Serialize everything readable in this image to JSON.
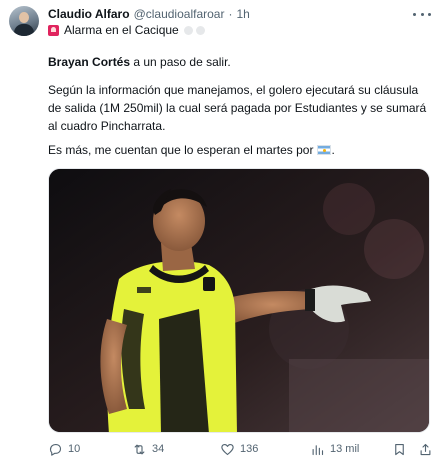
{
  "author": {
    "name": "Claudio Alfaro",
    "handle": "@claudioalfaroar",
    "separator": "·",
    "time": "1h"
  },
  "tweet": {
    "headline": "Alarma en el Cacique",
    "lead_bold": "Brayan Cortés",
    "lead_rest": " a un paso de salir.",
    "paragraph2": "Según la información que manejamos, el golero ejecutará su cláusula de salida (1M 250mil) la cual será pagada por Estudiantes y se sumará al cuadro Pincharrata.",
    "paragraph3": "Es más, me cuentan que lo esperan el martes por",
    "paragraph3_end": "."
  },
  "icons": {
    "headline_emoji": "siren-icon",
    "flag_emoji": "argentina-flag-icon"
  },
  "colors": {
    "text": "#0f1419",
    "secondary": "#536471",
    "jersey": "#e4f23a"
  },
  "actions": {
    "replies": "10",
    "retweets": "34",
    "likes": "136",
    "views": "13 mil"
  }
}
